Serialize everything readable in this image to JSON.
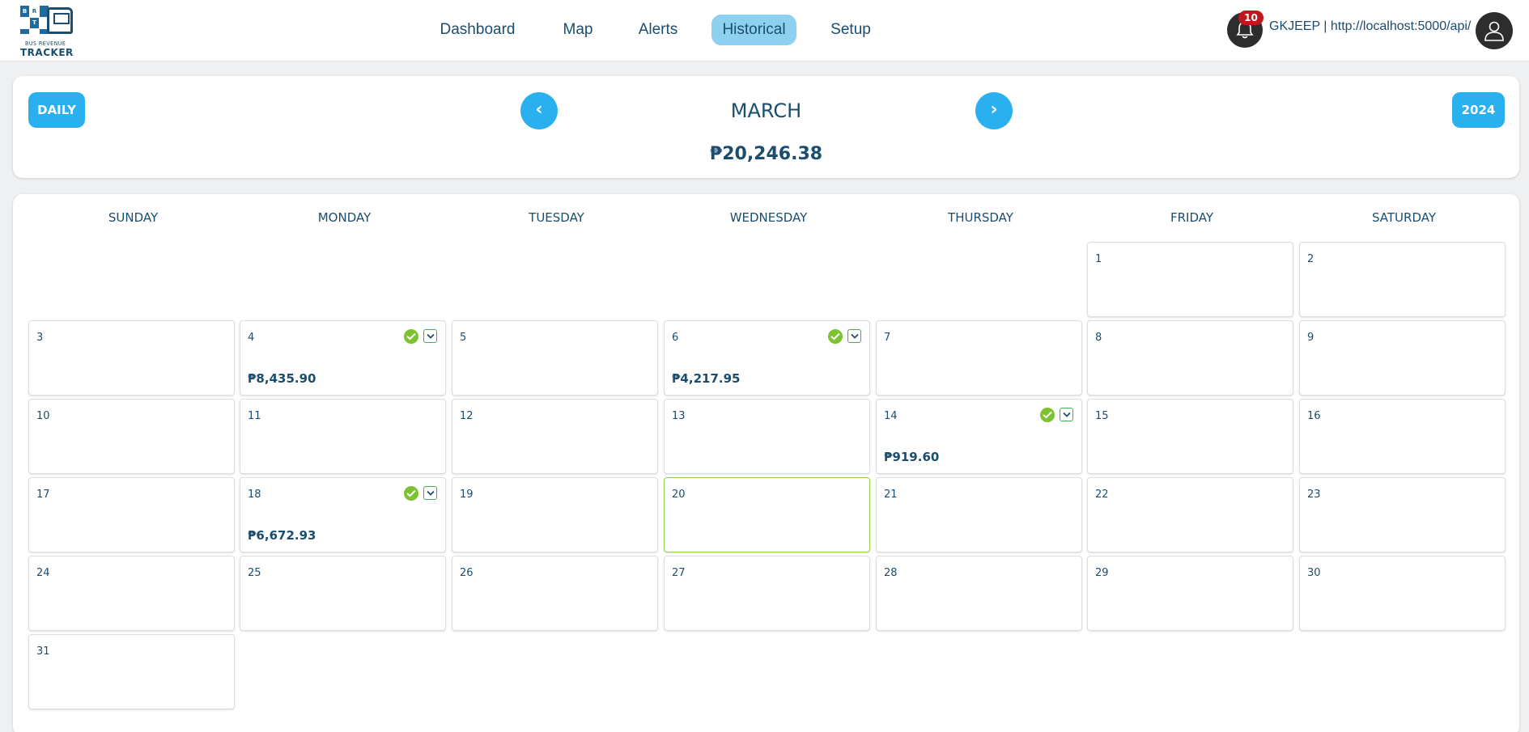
{
  "app": {
    "logo_sub": "BUS REVENUE",
    "logo_main": "TRACKER",
    "logo_letters": [
      "B",
      "R",
      "",
      "",
      "T",
      "",
      "",
      "",
      ""
    ]
  },
  "nav": {
    "items": [
      {
        "label": "Dashboard",
        "active": false
      },
      {
        "label": "Map",
        "active": false
      },
      {
        "label": "Alerts",
        "active": false
      },
      {
        "label": "Historical",
        "active": true
      },
      {
        "label": "Setup",
        "active": false
      }
    ]
  },
  "user": {
    "notification_count": "10",
    "info": "GKJEEP | http://localhost:5000/api/"
  },
  "month_panel": {
    "view_mode": "DAILY",
    "prev_icon": "‹",
    "next_icon": "›",
    "month": "MARCH",
    "year": "2024",
    "total": "₱20,246.38"
  },
  "calendar": {
    "weekdays": [
      "SUNDAY",
      "MONDAY",
      "TUESDAY",
      "WEDNESDAY",
      "THURSDAY",
      "FRIDAY",
      "SATURDAY"
    ],
    "first_weekday_index": 5,
    "days_in_month": 31,
    "today": 20,
    "entries": {
      "4": {
        "amount": "₱8,435.90",
        "verified": true
      },
      "6": {
        "amount": "₱4,217.95",
        "verified": true
      },
      "14": {
        "amount": "₱919.60",
        "verified": true
      },
      "18": {
        "amount": "₱6,672.93",
        "verified": true
      }
    }
  },
  "colors": {
    "accent": "#2ab0ef",
    "nav_active": "#8ed0ef",
    "text": "#1a4d6e",
    "check": "#7cc231",
    "today_border": "#8fd14f",
    "badge": "#c0161d"
  }
}
